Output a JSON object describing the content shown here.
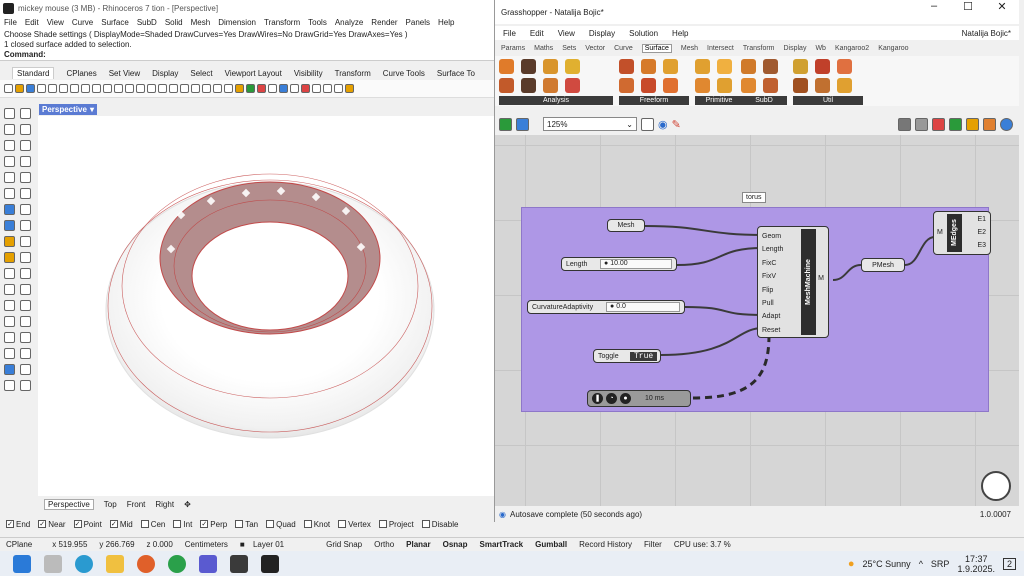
{
  "rhino": {
    "title": "mickey mouse (3 MB) - Rhinoceros 7 tion - [Perspective]",
    "menu": [
      "File",
      "Edit",
      "View",
      "Curve",
      "Surface",
      "SubD",
      "Solid",
      "Mesh",
      "Dimension",
      "Transform",
      "Tools",
      "Analyze",
      "Render",
      "Panels",
      "Help"
    ],
    "cmd_line1": "Choose Shade settings ( DisplayMode=Shaded  DrawCurves=Yes  DrawWires=No  DrawGrid=Yes  DrawAxes=Yes )",
    "cmd_line2": "1 closed surface added to selection.",
    "cmd_prompt": "Command:",
    "tabs": [
      "Standard",
      "CPlanes",
      "Set View",
      "Display",
      "Select",
      "Viewport Layout",
      "Visibility",
      "Transform",
      "Curve Tools",
      "Surface To"
    ],
    "viewport_label": "Perspective",
    "viewport_tabs": [
      "Perspective",
      "Top",
      "Front",
      "Right"
    ],
    "osnaps": [
      {
        "label": "End",
        "checked": true
      },
      {
        "label": "Near",
        "checked": true
      },
      {
        "label": "Point",
        "checked": true
      },
      {
        "label": "Mid",
        "checked": true
      },
      {
        "label": "Cen",
        "checked": false
      },
      {
        "label": "Int",
        "checked": false
      },
      {
        "label": "Perp",
        "checked": true
      },
      {
        "label": "Tan",
        "checked": false
      },
      {
        "label": "Quad",
        "checked": false
      },
      {
        "label": "Knot",
        "checked": false
      },
      {
        "label": "Vertex",
        "checked": false
      },
      {
        "label": "Project",
        "checked": false
      },
      {
        "label": "Disable",
        "checked": false
      }
    ]
  },
  "status": {
    "cplane": "CPlane",
    "x": "x 519.955",
    "y": "y 266.769",
    "z": "z 0.000",
    "units": "Centimeters",
    "layer": "Layer 01",
    "items": [
      "Grid Snap",
      "Ortho",
      "Planar",
      "Osnap",
      "SmartTrack",
      "Gumball",
      "Record History",
      "Filter"
    ],
    "cpu": "CPU use: 3.7 %"
  },
  "taskbar": {
    "weather": "25°C  Sunny",
    "lang": "SRP",
    "time": "17:37",
    "date": "1.9.2025.",
    "notif": "2"
  },
  "gh": {
    "title": "Grasshopper - Natalija Bojic*",
    "menu": [
      "File",
      "Edit",
      "View",
      "Display",
      "Solution",
      "Help"
    ],
    "user": "Natalija Bojic*",
    "tabs": [
      "Params",
      "Maths",
      "Sets",
      "Vector",
      "Curve",
      "Surface",
      "Mesh",
      "Intersect",
      "Transform",
      "Display",
      "Wb",
      "Kangaroo2",
      "Kangaroo"
    ],
    "active_tab": "Surface",
    "groups": [
      "Analysis",
      "Freeform",
      "Primitive",
      "SubD",
      "Util"
    ],
    "zoom": "125%",
    "group_tag": "torus",
    "nodes": {
      "mesh": "Mesh",
      "length_label": "Length",
      "length_value": "10.00",
      "curv_label": "CurvatureAdaptivity",
      "curv_value": "0.0",
      "toggle_label": "Toggle",
      "toggle_value": "True",
      "timer_value": "10 ms",
      "mm_name": "MeshMachine",
      "mm_inputs": [
        "Geom",
        "Length",
        "FixC",
        "FixV",
        "Flip",
        "Pull",
        "Adapt",
        "Reset"
      ],
      "mm_output": "M",
      "pmesh": "PMesh",
      "me_name": "MEdges",
      "me_input": "M",
      "me_outputs": [
        "E1",
        "E2",
        "E3"
      ]
    },
    "status": "Autosave complete (50 seconds ago)",
    "version": "1.0.0007"
  }
}
